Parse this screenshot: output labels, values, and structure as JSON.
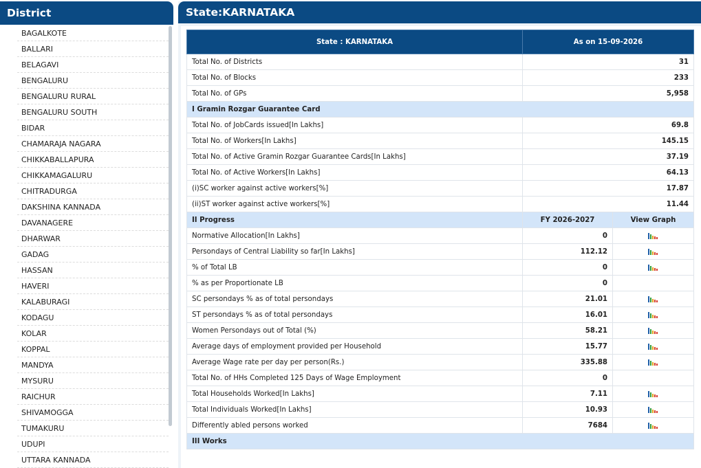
{
  "sidebar": {
    "title": "District",
    "districts": [
      "BAGALKOTE",
      "BALLARI",
      "BELAGAVI",
      "BENGALURU",
      "BENGALURU RURAL",
      "BENGALURU SOUTH",
      "BIDAR",
      "CHAMARAJA NAGARA",
      "CHIKKABALLAPURA",
      "CHIKKAMAGALURU",
      "CHITRADURGA",
      "DAKSHINA KANNADA",
      "DAVANAGERE",
      "DHARWAR",
      "GADAG",
      "HASSAN",
      "HAVERI",
      "KALABURAGI",
      "KODAGU",
      "KOLAR",
      "KOPPAL",
      "MANDYA",
      "MYSURU",
      "RAICHUR",
      "SHIVAMOGGA",
      "TUMAKURU",
      "UDUPI",
      "UTTARA KANNADA"
    ]
  },
  "main": {
    "title": "State:KARNATAKA",
    "table": {
      "head_state": "State : KARNATAKA",
      "head_date": "As on 15-09-2026",
      "summary": [
        {
          "label": "Total No. of Districts",
          "value": "31"
        },
        {
          "label": "Total No. of Blocks",
          "value": "233"
        },
        {
          "label": "Total No. of GPs",
          "value": "5,958"
        }
      ],
      "section1": {
        "title": "I Gramin Rozgar Guarantee Card",
        "rows": [
          {
            "label": "Total No. of JobCards issued[In Lakhs]",
            "value": "69.8"
          },
          {
            "label": "Total No. of Workers[In Lakhs]",
            "value": "145.15"
          },
          {
            "label": "Total No. of Active Gramin Rozgar Guarantee Cards[In Lakhs]",
            "value": "37.19"
          },
          {
            "label": "Total No. of Active Workers[In Lakhs]",
            "value": "64.13"
          },
          {
            "label": "(i)SC worker against active workers[%]",
            "value": "17.87"
          },
          {
            "label": "(ii)ST worker against active workers[%]",
            "value": "11.44"
          }
        ]
      },
      "section2": {
        "title": "II Progress",
        "col_fy": "FY 2026-2027",
        "col_graph": "View Graph",
        "rows": [
          {
            "label": "Normative Allocation[In Lakhs]",
            "value": "0",
            "graph": true
          },
          {
            "label": "Persondays of Central Liability so far[In Lakhs]",
            "value": "112.12",
            "graph": true
          },
          {
            "label": "% of Total LB",
            "value": "0",
            "graph": true
          },
          {
            "label": "% as per Proportionate LB",
            "value": "0",
            "graph": false
          },
          {
            "label": "SC persondays % as of total persondays",
            "value": "21.01",
            "graph": true
          },
          {
            "label": "ST persondays % as of total persondays",
            "value": "16.01",
            "graph": true
          },
          {
            "label": "Women Persondays out of Total (%)",
            "value": "58.21",
            "graph": true
          },
          {
            "label": "Average days of employment provided per Household",
            "value": "15.77",
            "graph": true
          },
          {
            "label": "Average Wage rate per day per person(Rs.)",
            "value": "335.88",
            "graph": true
          },
          {
            "label": "Total No. of HHs Completed 125 Days of Wage Employment",
            "value": "0",
            "graph": false
          },
          {
            "label": "Total Households Worked[In Lakhs]",
            "value": "7.11",
            "graph": true
          },
          {
            "label": "Total Individuals Worked[In Lakhs]",
            "value": "10.93",
            "graph": true
          },
          {
            "label": "Differently abled persons worked",
            "value": "7684",
            "graph": true
          }
        ]
      },
      "section3": {
        "title": "III Works"
      }
    }
  },
  "colors": {
    "header_blue": "#0b4a83",
    "section_bg": "#d3e5f9",
    "graph_icon": [
      "#1f5fa8",
      "#2e9a3a",
      "#e0a21b",
      "#d63a2a"
    ]
  }
}
